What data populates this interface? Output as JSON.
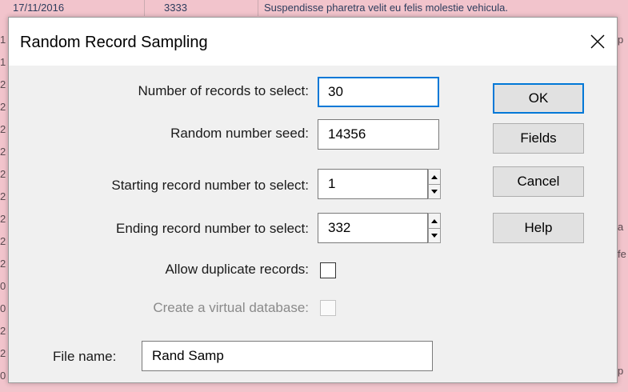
{
  "background": {
    "top_row": {
      "date": "17/11/2016",
      "number": "3333",
      "text": "Suspendisse pharetra velit eu felis molestie vehicula."
    },
    "left_column_digits": [
      "1",
      "1",
      "2",
      "2",
      "2",
      "2",
      "2",
      "2",
      "2",
      "2",
      "2",
      "0",
      "0",
      "2",
      "2",
      "0"
    ],
    "right_fragments": [
      "p",
      "a",
      "fe",
      "p"
    ]
  },
  "dialog": {
    "title": "Random Record Sampling",
    "fields": {
      "num_records": {
        "label": "Number of records to select:",
        "value": "30"
      },
      "seed": {
        "label": "Random number seed:",
        "value": "14356"
      },
      "start": {
        "label": "Starting record number to select:",
        "value": "1"
      },
      "end": {
        "label": "Ending record number to select:",
        "value": "332"
      },
      "allow_dup": {
        "label": "Allow duplicate records:",
        "checked": false
      },
      "virtual_db": {
        "label": "Create a virtual database:",
        "checked": false,
        "disabled": true
      },
      "file_name": {
        "label": "File name:",
        "value": "Rand Samp"
      }
    },
    "buttons": {
      "ok": "OK",
      "fields": "Fields",
      "cancel": "Cancel",
      "help": "Help"
    }
  },
  "colors": {
    "desktop_bg": "#f2c4cc",
    "accent": "#0078d7",
    "dialog_body": "#f0f0f0"
  }
}
